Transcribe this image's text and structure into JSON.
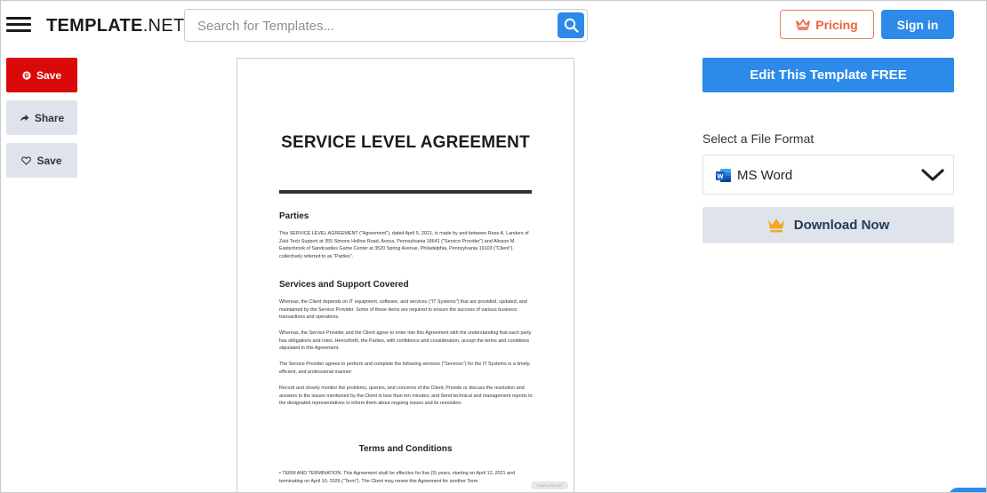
{
  "header": {
    "logo_bold": "TEMPLATE",
    "logo_light": ".NET",
    "search_placeholder": "Search for Templates...",
    "pricing_label": "Pricing",
    "signin_label": "Sign in"
  },
  "share": {
    "pin_save_label": "Save",
    "share_label": "Share",
    "heart_save_label": "Save"
  },
  "document": {
    "title": "SERVICE LEVEL AGREEMENT",
    "section_parties": "Parties",
    "parties_text": "This SERVICE LEVEL AGREEMENT (\"Agreement\"), dated April 5, 2021, is made by and between Rose A. Landers of Zukt Tech Support at 355 Simons Hollow Road, Avoca, Pennsylvania 18641 (\"Service Provider\") and Alisson M. Easterbrook of Sandcastles Game Center at 3520 Spring Avenue, Philadelphia, Pennsylvania 19103 (\"Client\"), collectively referred to as \"Parties\".",
    "section_services": "Services and Support Covered",
    "services_p1": "Whereas, the Client depends on IT equipment, software, and services (\"IT Systems\") that are provided, updated, and maintained by the Service Provider. Some of these items are required to ensure the success of various business transactions and operations.",
    "services_p2": "Whereas, the Service Provider and the Client agree to enter into this Agreement with the understanding that each party has obligations and roles. Henceforth, the Parties, with confidence and consideration, accept the terms and conditions stipulated in this Agreement.",
    "services_p3": "The Service Provider agrees to perform and complete the following services (\"Services\") for the IT Systems in a timely, efficient, and professional manner:",
    "services_p4": "Record and closely monitor the problems, queries, and concerns of the Client; Provide or discuss the resolution and answers to the issues mentioned by the Client in less than ten minutes; and Send technical and management reports to the designated representatives to inform them about ongoing issues and its resolution.",
    "section_terms": "Terms and Conditions",
    "terms_p1": "• TERM AND TERMINATION. This Agreement shall be effective for five (5) years, starting on April 12, 2021 and terminating on April 10, 2026 (\"Term\"). The Client may renew this Agreement for another Term.",
    "watermark": "TEMPLATE.NET"
  },
  "panel": {
    "edit_label": "Edit This Template FREE",
    "format_label": "Select a File Format",
    "format_value": "MS Word",
    "download_label": "Download Now"
  },
  "colors": {
    "accent_blue": "#2d8ae8",
    "pinterest_red": "#db0a0a",
    "pricing_orange": "#e8643a",
    "crown_orange": "#f5a623",
    "word_blue": "#2b579a"
  },
  "icons": [
    "hamburger-menu-icon",
    "search-icon",
    "crown-icon",
    "pinterest-icon",
    "share-arrow-icon",
    "heart-icon",
    "ms-word-icon",
    "chevron-down-icon"
  ]
}
